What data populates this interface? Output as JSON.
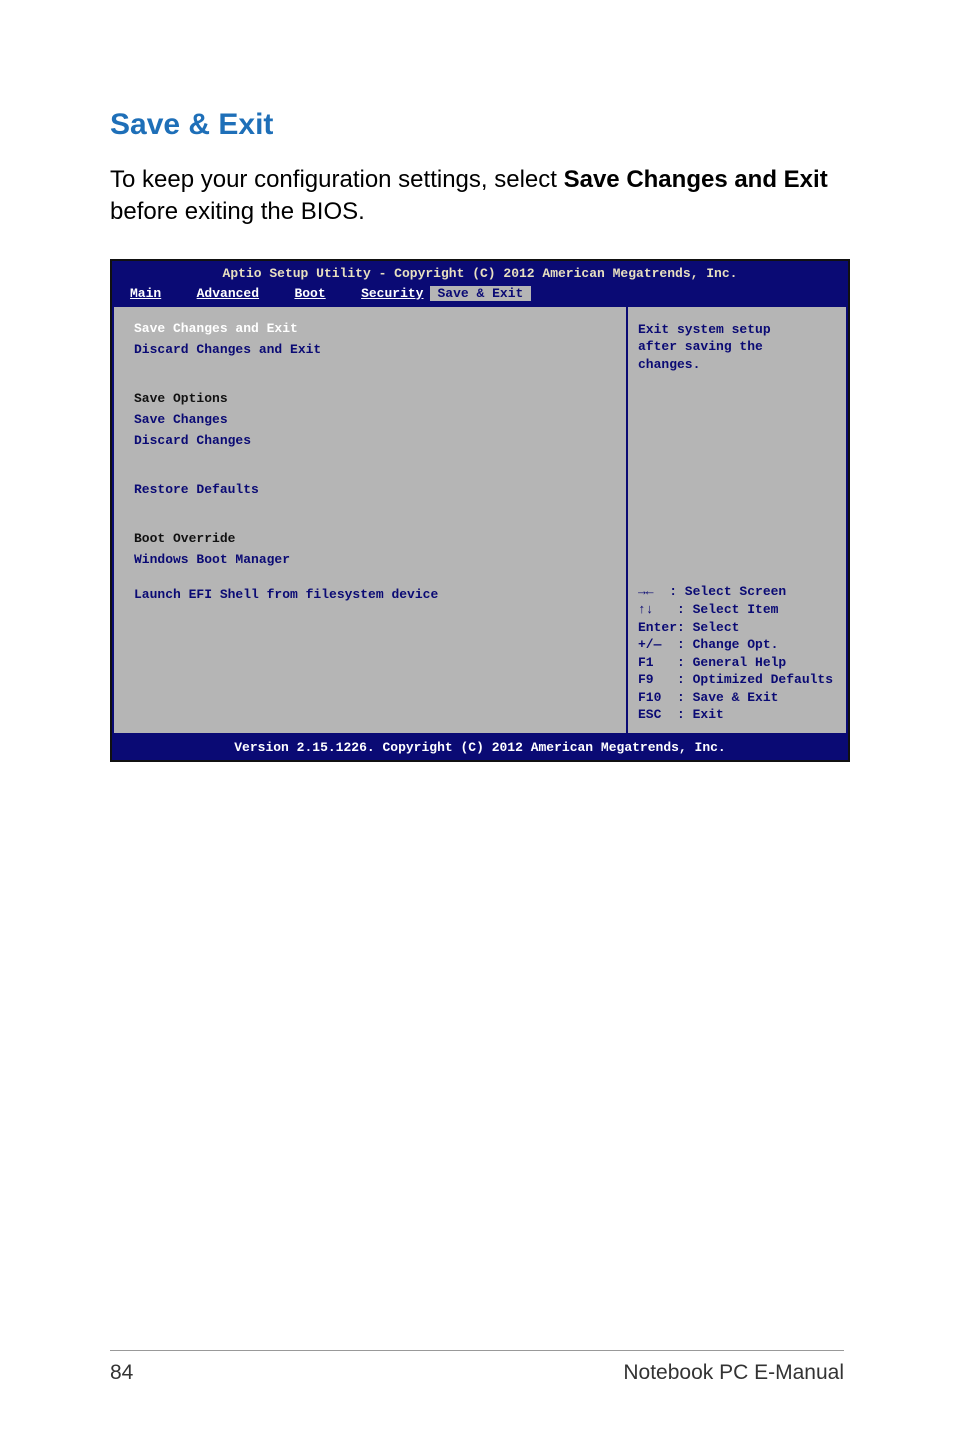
{
  "heading": "Save & Exit",
  "intro": {
    "part1": "To keep your configuration settings, select ",
    "bold": "Save Changes and Exit",
    "part2": " before exiting the BIOS."
  },
  "bios": {
    "titlebar": "Aptio Setup Utility - Copyright (C) 2012 American Megatrends, Inc.",
    "tabs": {
      "main": "Main",
      "advanced": "Advanced",
      "boot": "Boot",
      "security": "Security",
      "save_exit": "Save & Exit"
    },
    "left": {
      "save_changes_exit": "Save Changes and Exit",
      "discard_changes_exit": "Discard Changes and Exit",
      "save_options_header": "Save Options",
      "save_changes": "Save Changes",
      "discard_changes": "Discard Changes",
      "restore_defaults": "Restore Defaults",
      "boot_override_header": "Boot Override",
      "windows_boot_manager": "Windows Boot Manager",
      "launch_efi": "Launch EFI Shell from filesystem device"
    },
    "right": {
      "help_desc_1": "Exit system setup",
      "help_desc_2": "after saving the",
      "help_desc_3": "changes.",
      "nav_select_screen": "→←  : Select Screen",
      "nav_select_item": "↑↓   : Select Item",
      "nav_enter": "Enter: Select",
      "nav_change": "+/—  : Change Opt.",
      "nav_f1": "F1   : General Help",
      "nav_f9": "F9   : Optimized Defaults",
      "nav_f10": "F10  : Save & Exit",
      "nav_esc": "ESC  : Exit"
    },
    "footer": "Version 2.15.1226. Copyright (C) 2012 American Megatrends, Inc."
  },
  "page_footer": {
    "page_num": "84",
    "doc_title": "Notebook PC E-Manual"
  }
}
